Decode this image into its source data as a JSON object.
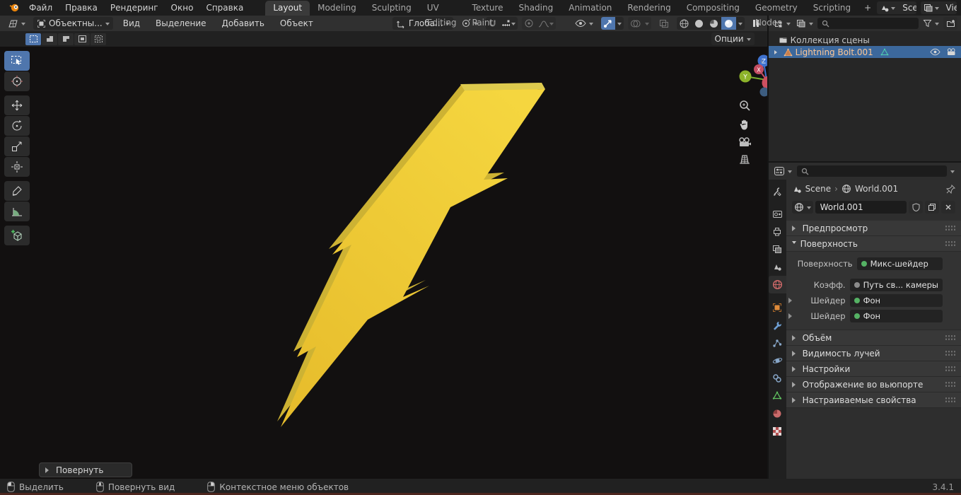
{
  "topbar": {
    "menus": [
      "Файл",
      "Правка",
      "Рендеринг",
      "Окно",
      "Справка"
    ],
    "tabs": [
      "Layout",
      "Modeling",
      "Sculpting",
      "UV Editing",
      "Texture Paint",
      "Shading",
      "Animation",
      "Rendering",
      "Compositing",
      "Geometry Nodes",
      "Scripting"
    ],
    "add_tab": "+",
    "active_tab": "Layout",
    "scene_selector": "Scene",
    "viewlayer_selector": "ViewLayer"
  },
  "viewport_header": {
    "mode": "Объектны...",
    "menus": [
      "Вид",
      "Выделение",
      "Добавить",
      "Объект"
    ],
    "orientation": "Глоба...",
    "options_label": "Опции"
  },
  "outliner": {
    "collection": "Коллекция сцены",
    "object": "Lightning Bolt.001"
  },
  "properties": {
    "breadcrumb": {
      "scene": "Scene",
      "separator": "›",
      "world": "World.001"
    },
    "name_field": "World.001",
    "panel_preview": "Предпросмотр",
    "panel_surface": "Поверхность",
    "surface_rows": [
      {
        "label": "Поверхность",
        "value": "Микс-шейдер"
      },
      {
        "label": "Коэфф.",
        "value": "Путь св... камеры"
      },
      {
        "label": "Шейдер",
        "value": "Фон"
      },
      {
        "label": "Шейдер",
        "value": "Фон"
      }
    ],
    "panels_collapsed": [
      "Объём",
      "Видимость лучей",
      "Настройки",
      "Отображение во вьюпорте",
      "Настраиваемые свойства"
    ]
  },
  "operator_panel": "Повернуть",
  "statusbar": {
    "items": [
      "Выделить",
      "Повернуть вид",
      "Контекстное меню объектов"
    ],
    "version": "3.4.1"
  },
  "colors": {
    "accent_blue": "#4f76ad",
    "selection_blue": "#3c689c",
    "bolt_yellow_light": "#f5d63f",
    "bolt_yellow_dark": "#e7bd2c",
    "bolt_side": "#cdb233",
    "viewport_bg": "#121010",
    "status_red_line": "#4d261e",
    "active_object_text": "#ffc795"
  }
}
